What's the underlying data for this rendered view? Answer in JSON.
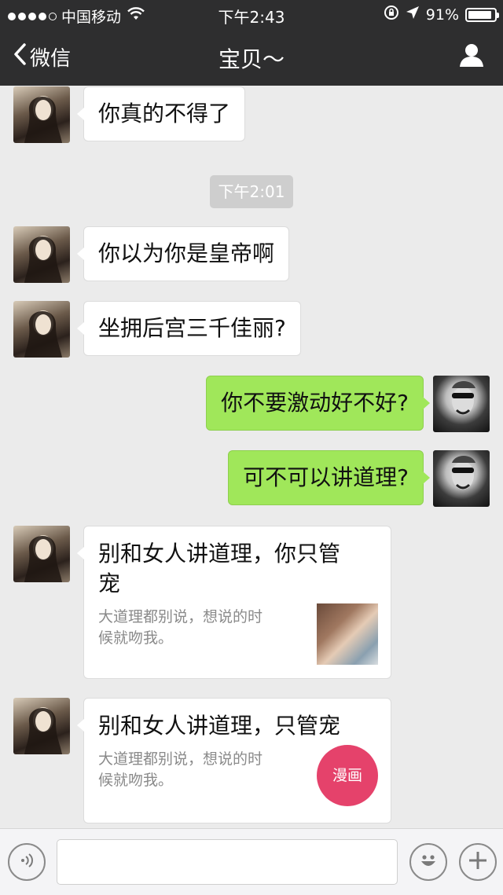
{
  "status_bar": {
    "carrier": "中国移动",
    "time": "下午2:43",
    "battery": "91%",
    "battery_level": 0.91
  },
  "nav": {
    "back_label": "微信",
    "title": "宝贝～"
  },
  "messages": [
    {
      "sender": "her",
      "text": "你真的不得了"
    },
    {
      "type": "time",
      "text": "下午2:01"
    },
    {
      "sender": "her",
      "text": "你以为你是皇帝啊"
    },
    {
      "sender": "her",
      "text": "坐拥后宫三千佳丽?"
    },
    {
      "sender": "me",
      "text": "你不要激动好不好?"
    },
    {
      "sender": "me",
      "text": "可不可以讲道理?"
    },
    {
      "sender": "her",
      "type": "link-card",
      "title_line1": "别和女人讲道理，你只管",
      "title_line2": "宠",
      "desc_line1": "大道理都别说，想说的时",
      "desc_line2": "候就吻我。"
    },
    {
      "sender": "her",
      "type": "link-card",
      "title_line1": "别和女人讲道理，只管宠",
      "desc_line1": "大道理都别说，想说的时",
      "desc_line2": "候就吻我。",
      "badge": "漫画"
    }
  ],
  "colors": {
    "bar_bg": "#2e2e2f",
    "chat_bg": "#ebebeb",
    "out_bubble": "#a0e75a",
    "badge": "#e5426b"
  },
  "icons": {
    "voice": "voice-icon",
    "emoji": "emoji-icon",
    "add": "plus-icon",
    "back": "chevron-left-icon",
    "profile": "person-icon"
  }
}
